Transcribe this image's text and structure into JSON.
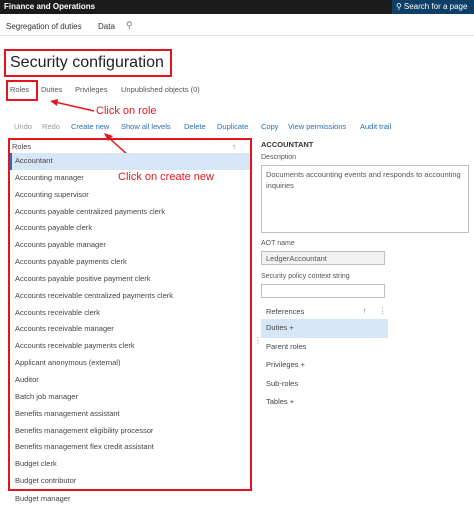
{
  "topbar": {
    "app_title": "Finance and Operations",
    "search_label": "Search for a page"
  },
  "navbar": {
    "items": [
      "Segregation of duties",
      "Data"
    ]
  },
  "page": {
    "title": "Security configuration"
  },
  "tabs": [
    "Roles",
    "Duties",
    "Privileges",
    "Unpublished objects (0)"
  ],
  "annotations": {
    "click_role": "Click on role",
    "click_create": "Click on create new"
  },
  "actions": [
    "Undo",
    "Redo",
    "Create new",
    "Show all levels",
    "Delete",
    "Duplicate",
    "Copy",
    "View permissions",
    "Audit trail"
  ],
  "roles": {
    "header": "Roles",
    "items": [
      "Accountant",
      "Accounting manager",
      "Accounting supervisor",
      "Accounts payable centralized payments clerk",
      "Accounts payable clerk",
      "Accounts payable manager",
      "Accounts payable payments clerk",
      "Accounts payable positive payment clerk",
      "Accounts receivable centralized payments clerk",
      "Accounts receivable clerk",
      "Accounts receivable manager",
      "Accounts receivable payments clerk",
      "Applicant anonymous (external)",
      "Auditor",
      "Batch job manager",
      "Benefits management assistant",
      "Benefits management eligibility processor",
      "Benefits management flex credit assistant",
      "Budget clerk",
      "Budget contributor"
    ],
    "below_frame": "Budget manager"
  },
  "detail": {
    "heading": "ACCOUNTANT",
    "description_label": "Description",
    "description_value": "Documents accounting events and responds to accounting inquiries",
    "aot_label": "AOT name",
    "aot_value": "LedgerAccountant",
    "policy_label": "Security policy context string",
    "policy_value": ""
  },
  "references": {
    "header": "References",
    "items": [
      "Duties +",
      "Parent roles",
      "Privileges +",
      "Sub-roles",
      "Tables +"
    ]
  }
}
